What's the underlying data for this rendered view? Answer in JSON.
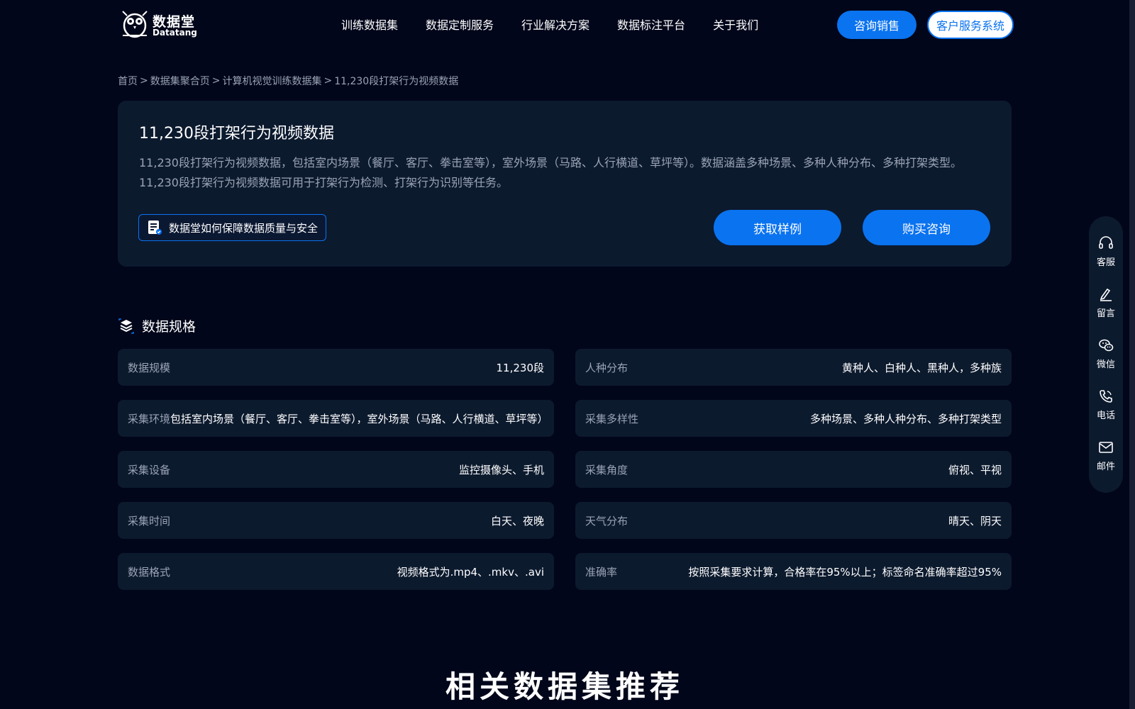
{
  "header": {
    "logo": {
      "cn": "数据堂",
      "en": "Datatang"
    },
    "nav": [
      {
        "label": "训练数据集"
      },
      {
        "label": "数据定制服务"
      },
      {
        "label": "行业解决方案"
      },
      {
        "label": "数据标注平台"
      },
      {
        "label": "关于我们"
      }
    ],
    "sales_label": "咨询销售",
    "cs_label": "客户服务系统"
  },
  "breadcrumb": {
    "items": [
      "首页",
      "数据集聚合页",
      "计算机视觉训练数据集",
      "11,230段打架行为视频数据"
    ],
    "separator": ">"
  },
  "hero": {
    "title": "11,230段打架行为视频数据",
    "desc_line1": "11,230段打架行为视频数据，包括室内场景（餐厅、客厅、拳击室等），室外场景（马路、人行横道、草坪等）。数据涵盖多种场景、多种人种分布、多种打架类型。",
    "desc_line2": "11,230段打架行为视频数据可用于打架行为检测、打架行为识别等任务。",
    "quality_link": "数据堂如何保障数据质量与安全",
    "sample_button": "获取样例",
    "buy_button": "购买咨询"
  },
  "specs": {
    "title": "数据规格",
    "items": [
      {
        "label": "数据规模",
        "value": "11,230段"
      },
      {
        "label": "人种分布",
        "value": "黄种人、白种人、黑种人，多种族"
      },
      {
        "label": "采集环境",
        "value": "包括室内场景（餐厅、客厅、拳击室等），室外场景（马路、人行横道、草坪等）"
      },
      {
        "label": "采集多样性",
        "value": "多种场景、多种人种分布、多种打架类型"
      },
      {
        "label": "采集设备",
        "value": "监控摄像头、手机"
      },
      {
        "label": "采集角度",
        "value": "俯视、平视"
      },
      {
        "label": "采集时间",
        "value": "白天、夜晚"
      },
      {
        "label": "天气分布",
        "value": "晴天、阴天"
      },
      {
        "label": "数据格式",
        "value": "视频格式为.mp4、.mkv、.avi"
      },
      {
        "label": "准确率",
        "value": "按照采集要求计算，合格率在95%以上；标签命名准确率超过95%"
      }
    ]
  },
  "related": {
    "heading": "相关数据集推荐"
  },
  "side_toolbar": {
    "items": [
      {
        "label": "客服",
        "icon": "headset-icon"
      },
      {
        "label": "留言",
        "icon": "pen-icon"
      },
      {
        "label": "微信",
        "icon": "wechat-icon"
      },
      {
        "label": "电话",
        "icon": "phone-icon"
      },
      {
        "label": "邮件",
        "icon": "mail-icon"
      }
    ]
  },
  "colors": {
    "background": "#02061a",
    "card": "#0c1a2e",
    "accent": "#0a73f0",
    "muted_text": "#9aa3b5"
  }
}
